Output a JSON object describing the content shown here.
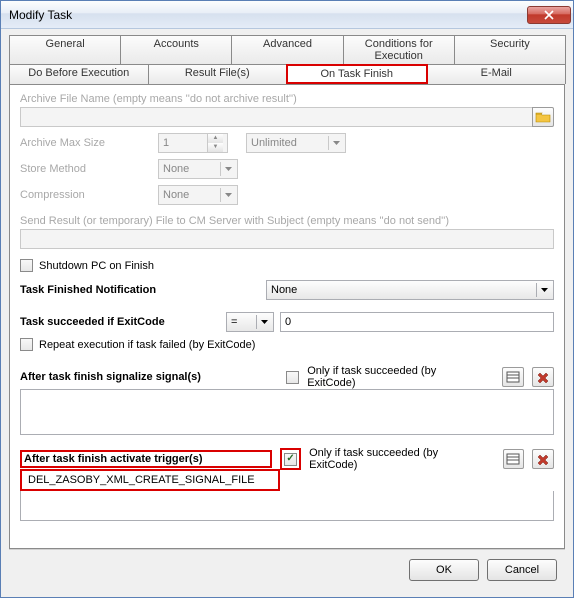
{
  "window": {
    "title": "Modify Task"
  },
  "tabs_row1": [
    "General",
    "Accounts",
    "Advanced",
    "Conditions for Execution",
    "Security"
  ],
  "tabs_row2": [
    "Do Before Execution",
    "Result File(s)",
    "On Task Finish",
    "E-Mail"
  ],
  "active_tab": "On Task Finish",
  "archive": {
    "name_label": "Archive File Name (empty means ''do not archive result'')",
    "max_size_label": "Archive Max Size",
    "max_size_value": "1",
    "max_size_unit": "Unlimited",
    "store_label": "Store Method",
    "store_value": "None",
    "compression_label": "Compression",
    "compression_value": "None"
  },
  "send_result_label": "Send Result (or temporary) File to CM Server with Subject (empty means ''do not send'')",
  "shutdown_label": "Shutdown PC on Finish",
  "notification": {
    "label": "Task Finished Notification",
    "value": "None"
  },
  "succeeded": {
    "label": "Task succeeded if ExitCode",
    "op": "=",
    "value": "0"
  },
  "repeat_label": "Repeat execution if task failed (by ExitCode)",
  "signalize": {
    "label": "After task finish signalize signal(s)",
    "only_label": "Only if task succeeded (by ExitCode)"
  },
  "activate": {
    "label": "After task finish activate trigger(s)",
    "only_label": "Only if task succeeded (by ExitCode)",
    "item": "DEL_ZASOBY_XML_CREATE_SIGNAL_FILE"
  },
  "buttons": {
    "ok": "OK",
    "cancel": "Cancel"
  }
}
